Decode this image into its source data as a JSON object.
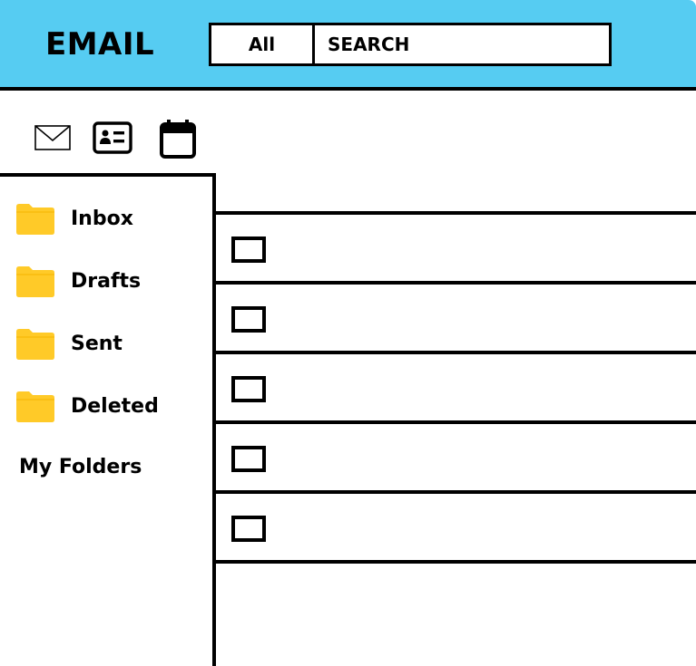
{
  "header": {
    "app_title": "EMAIL",
    "scope_label": "All",
    "search_placeholder": "SEARCH",
    "background": "#56ccf2"
  },
  "toolbar": {
    "icons": [
      "mail-icon",
      "contact-card-icon",
      "calendar-icon"
    ]
  },
  "sidebar": {
    "folders": [
      {
        "label": "Inbox",
        "icon": "folder-icon"
      },
      {
        "label": "Drafts",
        "icon": "folder-icon"
      },
      {
        "label": "Sent",
        "icon": "folder-icon"
      },
      {
        "label": "Deleted",
        "icon": "folder-icon"
      }
    ],
    "my_folders_label": "My Folders",
    "folder_color": "#ffca28"
  },
  "message_list": {
    "row_count": 5,
    "rows": [
      {},
      {},
      {},
      {},
      {}
    ]
  }
}
